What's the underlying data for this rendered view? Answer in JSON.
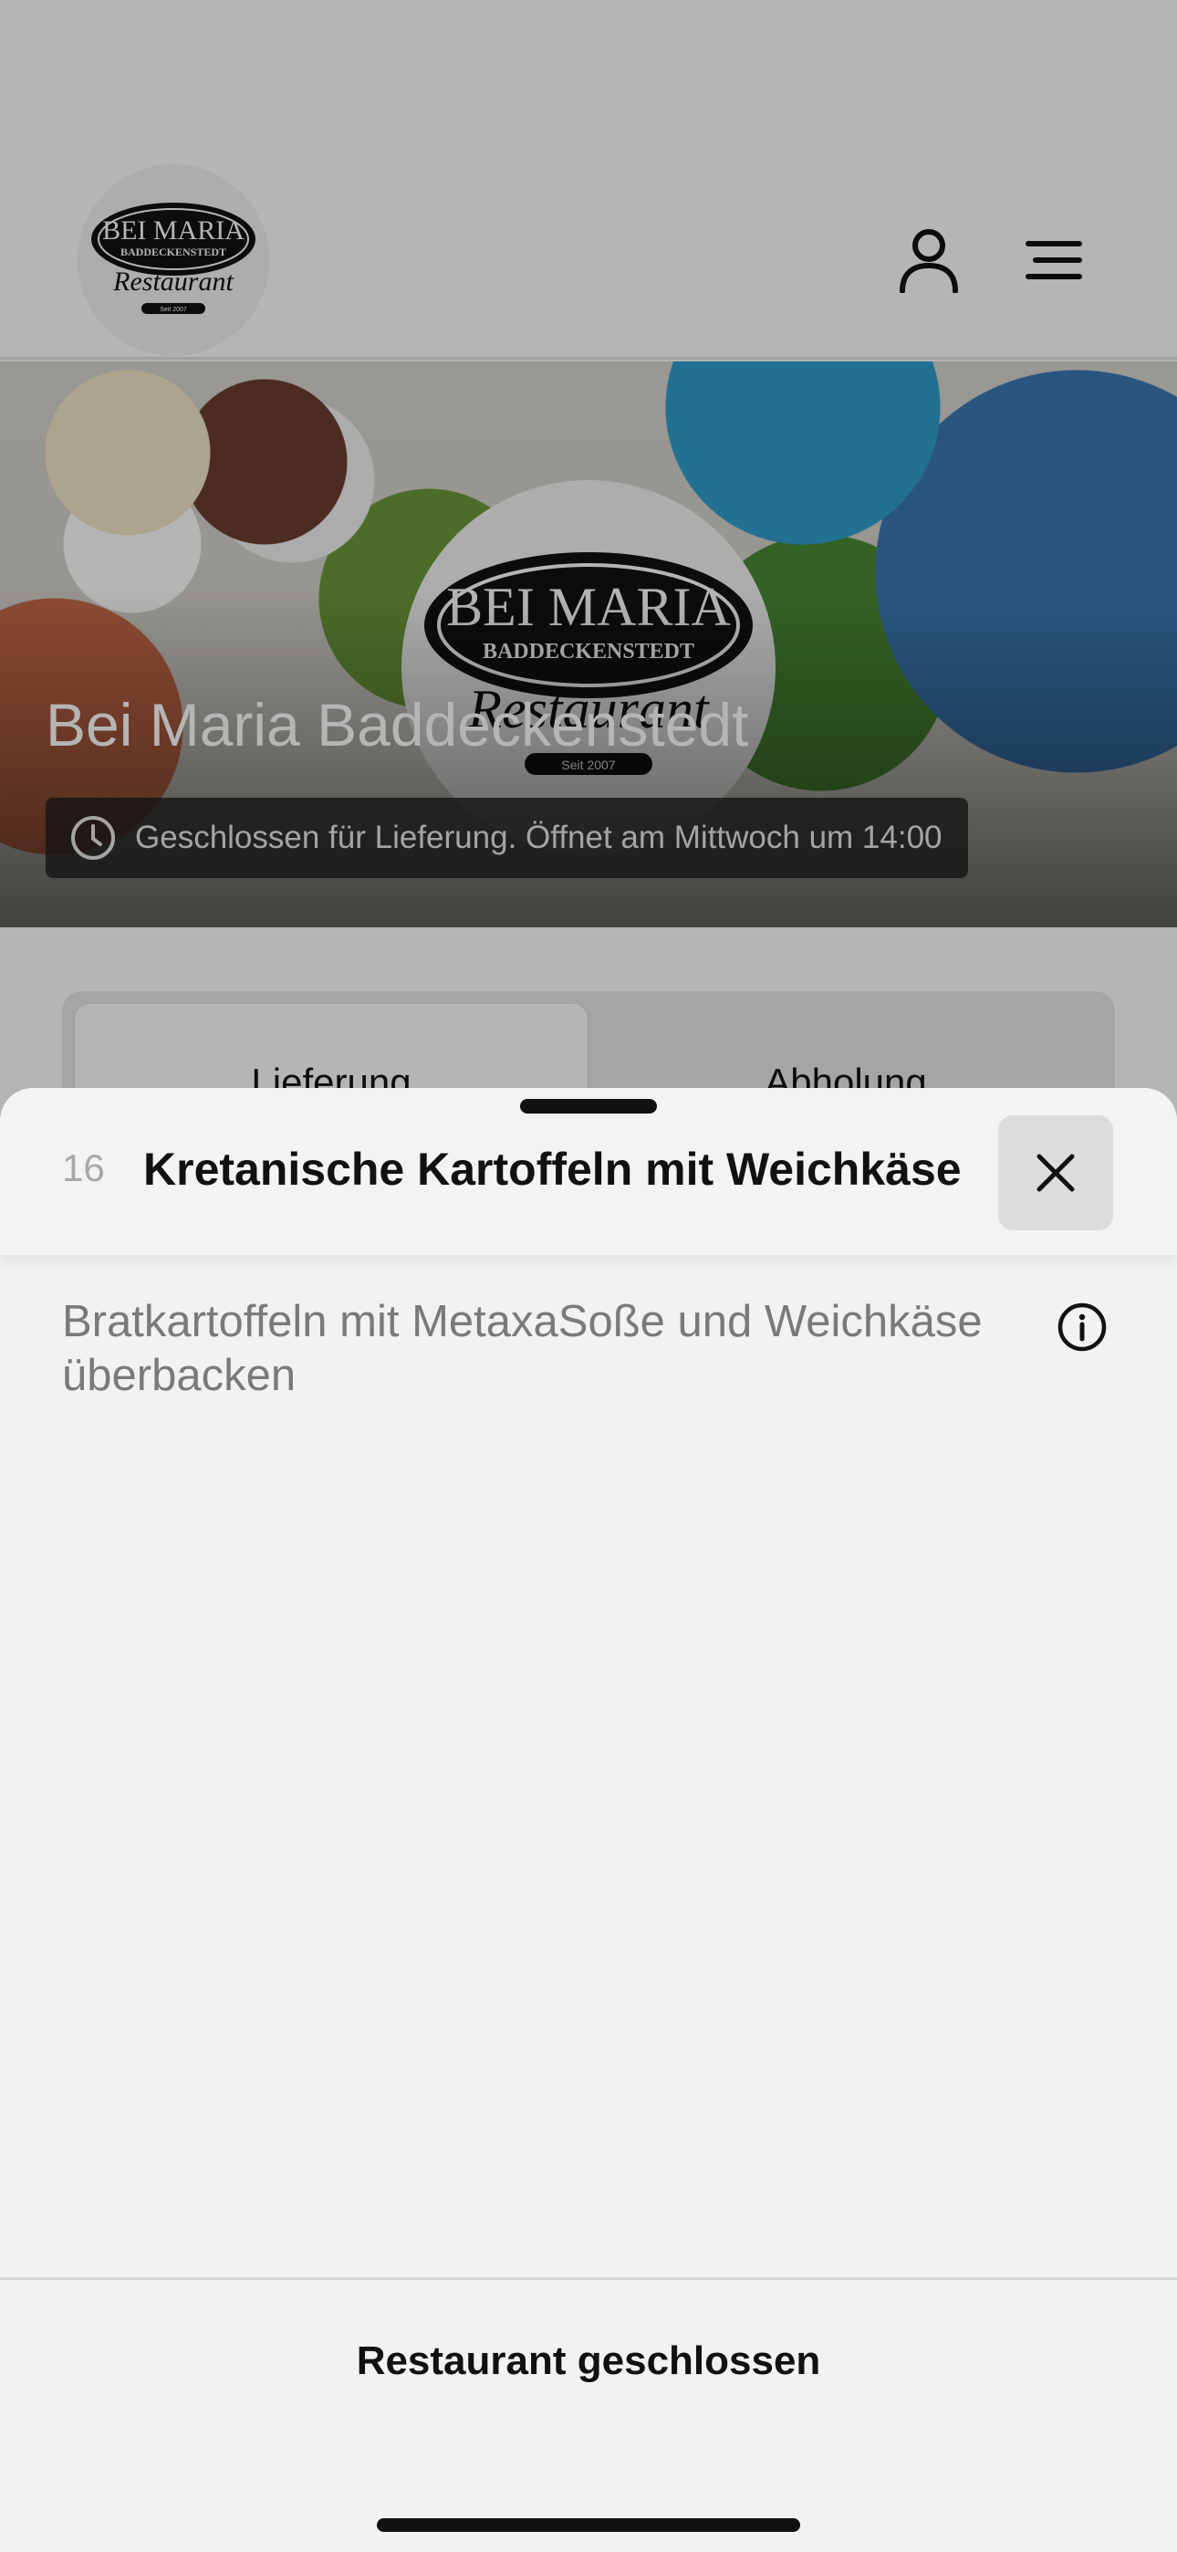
{
  "app": {
    "logo": {
      "line1": "BEI MARIA",
      "line2": "BADDECKENSTEDT",
      "line3": "Restaurant",
      "line4": "Seit 2007"
    },
    "header_icons": [
      "user-icon",
      "menu-icon"
    ]
  },
  "hero": {
    "title": "Bei Maria Baddeckenstedt",
    "status": "Geschlossen für Lieferung. Öffnet am Mittwoch um 14:00",
    "status_icon": "clock-icon"
  },
  "order_mode": {
    "options": [
      "Lieferung",
      "Abholung"
    ],
    "selected": "Lieferung"
  },
  "sheet": {
    "item_number": "16",
    "item_title": "Kretanische Kartoffeln mit Weichkäse",
    "description": "Bratkartoffeln mit MetaxaSoße und Weichkäse überbacken",
    "close_icon": "close-icon",
    "info_icon": "info-icon",
    "footer_status": "Restaurant geschlossen"
  },
  "colors": {
    "sheet_bg": "#f2f2f2",
    "scrim": "rgba(0,0,0,0.29)",
    "text_primary": "#111111",
    "text_secondary": "#7a7a7a"
  }
}
